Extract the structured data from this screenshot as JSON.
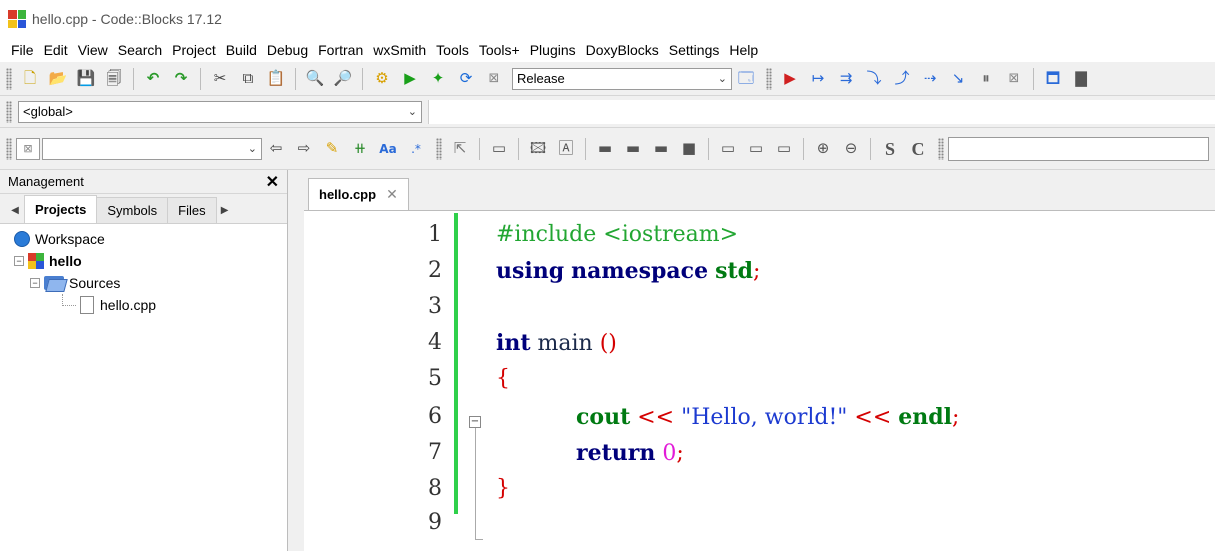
{
  "window": {
    "title": "hello.cpp - Code::Blocks 17.12"
  },
  "menu": [
    "File",
    "Edit",
    "View",
    "Search",
    "Project",
    "Build",
    "Debug",
    "Fortran",
    "wxSmith",
    "Tools",
    "Tools+",
    "Plugins",
    "DoxyBlocks",
    "Settings",
    "Help"
  ],
  "toolbar": {
    "build_target": "Release",
    "scope": "<global>"
  },
  "management": {
    "title": "Management",
    "tabs": [
      "Projects",
      "Symbols",
      "Files"
    ],
    "tree": {
      "workspace": "Workspace",
      "project": "hello",
      "folder": "Sources",
      "file": "hello.cpp"
    }
  },
  "editor": {
    "tab": "hello.cpp",
    "line_numbers": [
      "1",
      "2",
      "3",
      "4",
      "5",
      "6",
      "7",
      "8",
      "9"
    ],
    "code": {
      "l1": "#include <iostream>",
      "l2_kw1": "using",
      "l2_kw2": "namespace",
      "l2_std": "std",
      "l2_semi": ";",
      "l4_kw": "int",
      "l4_id": "main",
      "l4_paren": "()",
      "l5_brace": "{",
      "l6_cout": "cout",
      "l6_op1": "<<",
      "l6_str": "\"Hello, world!\"",
      "l6_op2": "<<",
      "l6_endl": "endl",
      "l6_semi": ";",
      "l7_kw": "return",
      "l7_num": "0",
      "l7_semi": ";",
      "l8_brace": "}"
    }
  },
  "colors": {
    "brand_red": "#d83b2a",
    "brand_green": "#3cb43c",
    "brand_blue": "#2a56d8",
    "brand_yellow": "#f2c21b",
    "change_bar": "#2fd04b"
  }
}
